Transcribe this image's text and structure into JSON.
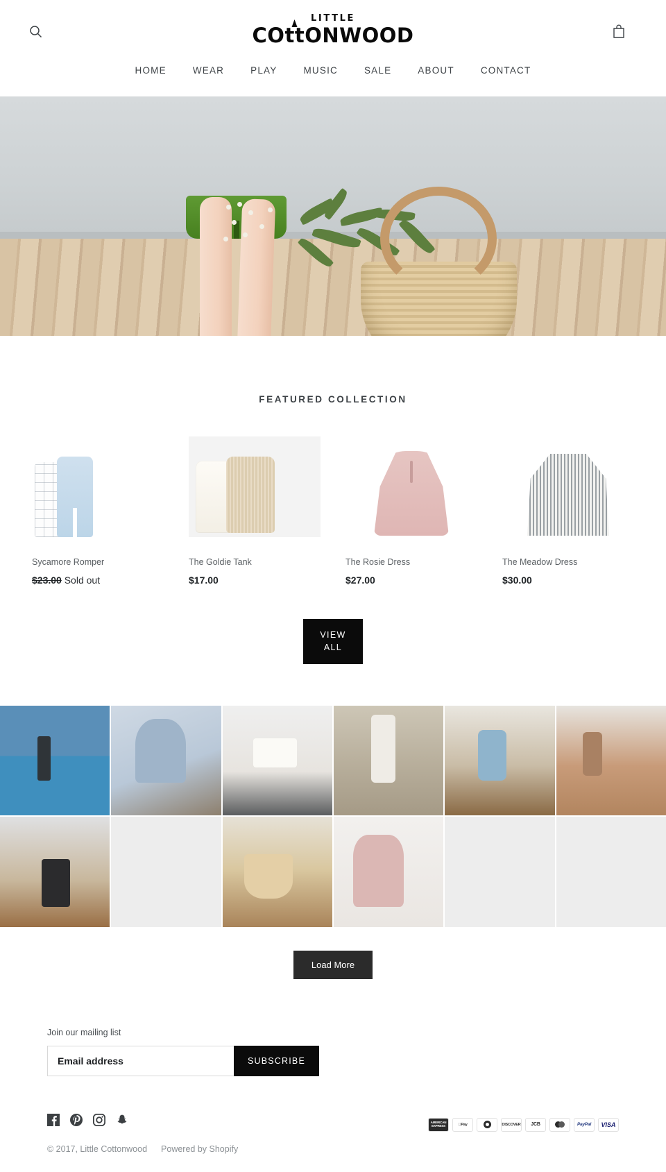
{
  "header": {
    "search_icon": "search-icon",
    "cart_icon": "shopping-bag-icon",
    "logo_top": "LITTLE",
    "logo_main_part1": "CO",
    "logo_main_tt": "tt",
    "logo_main_part2": "ONWOOD"
  },
  "nav": {
    "items": [
      {
        "label": "HOME"
      },
      {
        "label": "WEAR"
      },
      {
        "label": "PLAY"
      },
      {
        "label": "MUSIC"
      },
      {
        "label": "SALE"
      },
      {
        "label": "ABOUT"
      },
      {
        "label": "CONTACT"
      }
    ]
  },
  "featured": {
    "title": "FEATURED COLLECTION",
    "products": [
      {
        "title": "Sycamore Romper",
        "price_was": "$23.00",
        "price_note": "Sold out",
        "price": ""
      },
      {
        "title": "The Goldie Tank",
        "price_was": "",
        "price_note": "",
        "price": "$17.00"
      },
      {
        "title": "The Rosie Dress",
        "price_was": "",
        "price_note": "",
        "price": "$27.00"
      },
      {
        "title": "The Meadow Dress",
        "price_was": "",
        "price_note": "",
        "price": "$30.00"
      }
    ],
    "view_all_line1": "VIEW",
    "view_all_line2": "ALL"
  },
  "instagram": {
    "load_more": "Load More"
  },
  "footer": {
    "newsletter_label": "Join our mailing list",
    "email_placeholder": "Email address",
    "email_value": "",
    "subscribe_label": "SUBSCRIBE",
    "social": [
      {
        "name": "facebook-icon"
      },
      {
        "name": "pinterest-icon"
      },
      {
        "name": "instagram-icon"
      },
      {
        "name": "snapchat-icon"
      }
    ],
    "copyright": "© 2017, Little Cottonwood",
    "powered_by": "Powered by Shopify",
    "payments": [
      {
        "label": "AMERICAN EXPRESS",
        "kind": "amex"
      },
      {
        "label": "Apple Pay",
        "kind": "apple"
      },
      {
        "label": "Diners Club",
        "kind": "diners"
      },
      {
        "label": "DISCOVER",
        "kind": "discover"
      },
      {
        "label": "JCB",
        "kind": "jcb"
      },
      {
        "label": "Mastercard",
        "kind": "mc"
      },
      {
        "label": "PayPal",
        "kind": "pp"
      },
      {
        "label": "VISA",
        "kind": "visa"
      }
    ]
  },
  "colors": {
    "accent": "#0b0b0b",
    "text": "#3d4246",
    "muted": "#8c9195",
    "placeholder_tile": "#ededed"
  }
}
